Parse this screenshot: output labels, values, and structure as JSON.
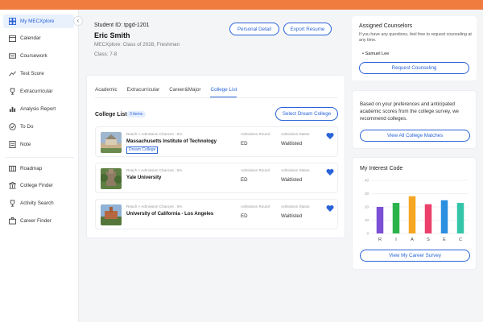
{
  "sidebar": {
    "items": [
      {
        "label": "My MECXplore",
        "icon": "dashboard-icon",
        "active": true
      },
      {
        "label": "Calendar",
        "icon": "calendar-icon"
      },
      {
        "label": "Coursework",
        "icon": "book-icon"
      },
      {
        "label": "Test Score",
        "icon": "trend-icon"
      },
      {
        "label": "Extracurricular",
        "icon": "trophy-icon"
      },
      {
        "label": "Analysis Report",
        "icon": "chart-icon"
      },
      {
        "label": "To Do",
        "icon": "check-icon"
      },
      {
        "label": "Note",
        "icon": "note-icon"
      },
      {
        "label": "Roadmap",
        "icon": "map-icon"
      },
      {
        "label": "College Finder",
        "icon": "building-icon"
      },
      {
        "label": "Activity Search",
        "icon": "trophy-icon"
      },
      {
        "label": "Career Finder",
        "icon": "briefcase-icon"
      }
    ],
    "collapse_glyph": "‹"
  },
  "profile": {
    "student_id": "Student ID: tpgd-1201",
    "name": "Eric Smith",
    "class_of": "MECXplore: Class of 2028, Freshman",
    "grade": "Class: 7-8",
    "personal_detail_label": "Personal Detail",
    "export_resume_label": "Export Resume"
  },
  "tabs": [
    "Academic",
    "Extracurricular",
    "Career&Major",
    "College List"
  ],
  "active_tab": "College List",
  "college_list": {
    "title": "College List",
    "count": "3 items",
    "dream_button": "Select Dream College",
    "round_label": "Admission Round",
    "status_label": "Admission Status",
    "colleges": [
      {
        "chance": "Reach > Admission Chances : 5%",
        "name": "Massachusetts Institute of Technology",
        "dream": "Dream College",
        "round": "ED",
        "status": "Waitlisted",
        "favorite": true
      },
      {
        "chance": "Reach > Admission Chances : 5%",
        "name": "Yale University",
        "dream": "",
        "round": "ED",
        "status": "Waitlisted",
        "favorite": true
      },
      {
        "chance": "Reach > Admission Chances : 5%",
        "name": "University of California - Los Angeles",
        "dream": "",
        "round": "ED",
        "status": "Waitlisted",
        "favorite": true
      }
    ]
  },
  "counselors": {
    "title": "Assigned Counselors",
    "desc": "If you have any questions, feel free to request counseling at any time.",
    "name": "Samuel Lee",
    "button": "Request Counseling"
  },
  "recommend": {
    "desc": "Based on your preferences and anticipated academic scores from the college survey, we recommend colleges.",
    "button": "View All College Matches"
  },
  "interest": {
    "title": "My Interest Code",
    "button": "View My Career Survey"
  },
  "chart_data": {
    "type": "bar",
    "categories": [
      "R",
      "I",
      "A",
      "S",
      "E",
      "C"
    ],
    "values": [
      20,
      23,
      28,
      22,
      25,
      23
    ],
    "colors": [
      "#7b4fd6",
      "#2bb34a",
      "#f5a623",
      "#ec3f6a",
      "#2d8fe0",
      "#34c5a9"
    ],
    "yticks": [
      0,
      10,
      20,
      30,
      40
    ],
    "ylim": [
      0,
      40
    ],
    "grid": true
  },
  "colors": {
    "accent": "#2a63d8",
    "brand": "#f07d3f",
    "favorite": "#2a63d8"
  }
}
